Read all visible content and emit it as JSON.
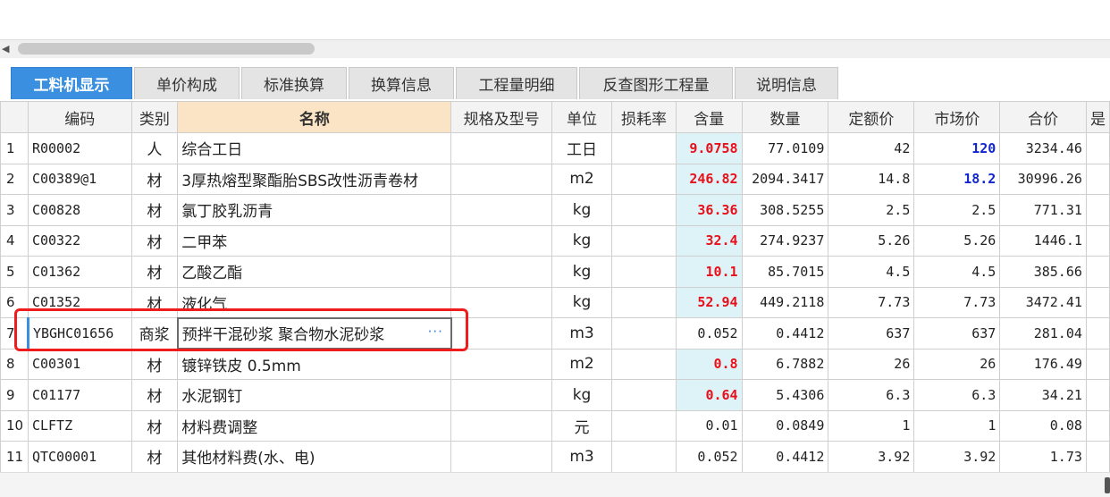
{
  "tabs": [
    {
      "label": "工料机显示",
      "active": true
    },
    {
      "label": "单价构成",
      "active": false
    },
    {
      "label": "标准换算",
      "active": false
    },
    {
      "label": "换算信息",
      "active": false
    },
    {
      "label": "工程量明细",
      "active": false
    },
    {
      "label": "反查图形工程量",
      "active": false
    },
    {
      "label": "说明信息",
      "active": false
    }
  ],
  "columns": [
    "",
    "编码",
    "类别",
    "名称",
    "规格及型号",
    "单位",
    "损耗率",
    "含量",
    "数量",
    "定额价",
    "市场价",
    "合价",
    "是"
  ],
  "rows": [
    {
      "no": "1",
      "code": "R00002",
      "type": "人",
      "name": "综合工日",
      "spec": "",
      "unit": "工日",
      "loss": "",
      "qty": "9.0758",
      "amount": "77.0109",
      "quota": "42",
      "market": "120",
      "total": "3234.46"
    },
    {
      "no": "2",
      "code": "C00389@1",
      "type": "材",
      "name": "3厚热熔型聚酯胎SBS改性沥青卷材",
      "spec": "",
      "unit": "m2",
      "loss": "",
      "qty": "246.82",
      "amount": "2094.3417",
      "quota": "14.8",
      "market": "18.2",
      "total": "30996.26"
    },
    {
      "no": "3",
      "code": "C00828",
      "type": "材",
      "name": "氯丁胶乳沥青",
      "spec": "",
      "unit": "kg",
      "loss": "",
      "qty": "36.36",
      "amount": "308.5255",
      "quota": "2.5",
      "market": "2.5",
      "total": "771.31"
    },
    {
      "no": "4",
      "code": "C00322",
      "type": "材",
      "name": "二甲苯",
      "spec": "",
      "unit": "kg",
      "loss": "",
      "qty": "32.4",
      "amount": "274.9237",
      "quota": "5.26",
      "market": "5.26",
      "total": "1446.1"
    },
    {
      "no": "5",
      "code": "C01362",
      "type": "材",
      "name": "乙酸乙酯",
      "spec": "",
      "unit": "kg",
      "loss": "",
      "qty": "10.1",
      "amount": "85.7015",
      "quota": "4.5",
      "market": "4.5",
      "total": "385.66"
    },
    {
      "no": "6",
      "code": "C01352",
      "type": "材",
      "name": "液化气",
      "spec": "",
      "unit": "kg",
      "loss": "",
      "qty": "52.94",
      "amount": "449.2118",
      "quota": "7.73",
      "market": "7.73",
      "total": "3472.41"
    },
    {
      "no": "7",
      "code": "YBGHC01656",
      "type": "商浆",
      "name": "预拌干混砂浆 聚合物水泥砂浆",
      "spec": "",
      "unit": "m3",
      "loss": "",
      "qty": "0.052",
      "amount": "0.4412",
      "quota": "637",
      "market": "637",
      "total": "281.04"
    },
    {
      "no": "8",
      "code": "C00301",
      "type": "材",
      "name": "镀锌铁皮 0.5mm",
      "spec": "",
      "unit": "m2",
      "loss": "",
      "qty": "0.8",
      "amount": "6.7882",
      "quota": "26",
      "market": "26",
      "total": "176.49"
    },
    {
      "no": "9",
      "code": "C01177",
      "type": "材",
      "name": "水泥钢钉",
      "spec": "",
      "unit": "kg",
      "loss": "",
      "qty": "0.64",
      "amount": "5.4306",
      "quota": "6.3",
      "market": "6.3",
      "total": "34.21"
    },
    {
      "no": "10",
      "code": "CLFTZ",
      "type": "材",
      "name": "材料费调整",
      "spec": "",
      "unit": "元",
      "loss": "",
      "qty": "0.01",
      "amount": "0.0849",
      "quota": "1",
      "market": "1",
      "total": "0.08"
    },
    {
      "no": "11",
      "code": "QTC00001",
      "type": "材",
      "name": "其他材料费(水、电)",
      "spec": "",
      "unit": "m3",
      "loss": "",
      "qty": "0.052",
      "amount": "0.4412",
      "quota": "3.92",
      "market": "3.92",
      "total": "1.73"
    }
  ],
  "highlight": {
    "qty_red_rows": [
      0,
      1,
      2,
      3,
      4,
      5,
      7,
      8
    ],
    "market_blue_rows": [
      0,
      1
    ],
    "editing_row": 6
  },
  "editor_ellipsis": "···",
  "colors": {
    "accent": "#3b8fe0",
    "red_value": "#e8101a",
    "blue_value": "#1226d0",
    "highlight_bg": "#def3f8",
    "annotation_box": "#ee1c1c"
  }
}
